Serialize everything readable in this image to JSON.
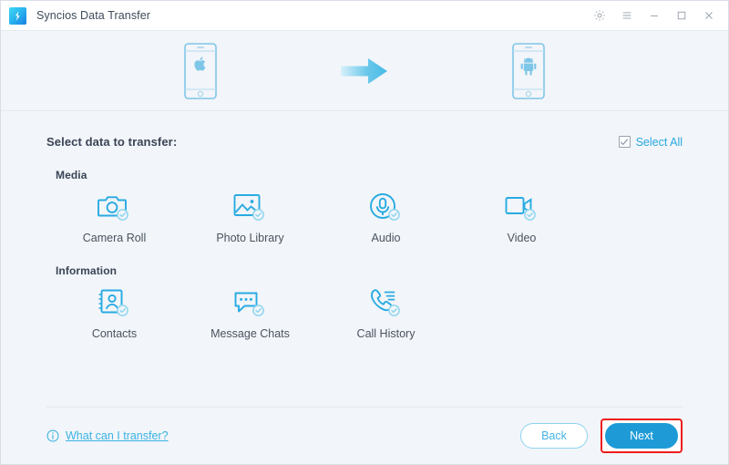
{
  "window": {
    "title": "Syncios Data Transfer",
    "logo_icon": "syncios-logo-icon",
    "controls": [
      {
        "name": "settings-button",
        "icon": "gear-icon"
      },
      {
        "name": "menu-button",
        "icon": "hamburger-menu-icon"
      },
      {
        "name": "minimize-button",
        "icon": "minimize-icon"
      },
      {
        "name": "maximize-button",
        "icon": "maximize-icon"
      },
      {
        "name": "close-button",
        "icon": "close-icon"
      }
    ]
  },
  "transfer_strip": {
    "source_device": {
      "icon": "apple-phone-icon",
      "platform": "Apple"
    },
    "arrow": {
      "icon": "arrow-right-icon"
    },
    "target_device": {
      "icon": "android-phone-icon",
      "platform": "Android"
    }
  },
  "main": {
    "select_label": "Select data to transfer:",
    "select_all": {
      "label": "Select All",
      "checked": true,
      "checkbox_icon": "checkmark-icon"
    },
    "groups": [
      {
        "title": "Media",
        "items": [
          {
            "label": "Camera Roll",
            "icon": "camera-icon",
            "checked": true
          },
          {
            "label": "Photo Library",
            "icon": "photo-icon",
            "checked": true
          },
          {
            "label": "Audio",
            "icon": "microphone-icon",
            "checked": true
          },
          {
            "label": "Video",
            "icon": "camcorder-icon",
            "checked": true
          }
        ]
      },
      {
        "title": "Information",
        "items": [
          {
            "label": "Contacts",
            "icon": "contact-card-icon",
            "checked": true
          },
          {
            "label": "Message Chats",
            "icon": "speech-bubble-icon",
            "checked": true
          },
          {
            "label": "Call History",
            "icon": "phone-handset-icon",
            "checked": true
          }
        ]
      }
    ]
  },
  "footer": {
    "help_link": {
      "label": "What can I transfer?",
      "icon": "info-icon"
    },
    "back_label": "Back",
    "next_label": "Next"
  },
  "colors": {
    "accent_blue": "#28a8e0",
    "icon_blue": "#29abe2",
    "next_button": "#1e9bd7",
    "highlight_red": "#ee1c1c",
    "background": "#f2f5f9",
    "title_text": "#3e4a5a"
  }
}
